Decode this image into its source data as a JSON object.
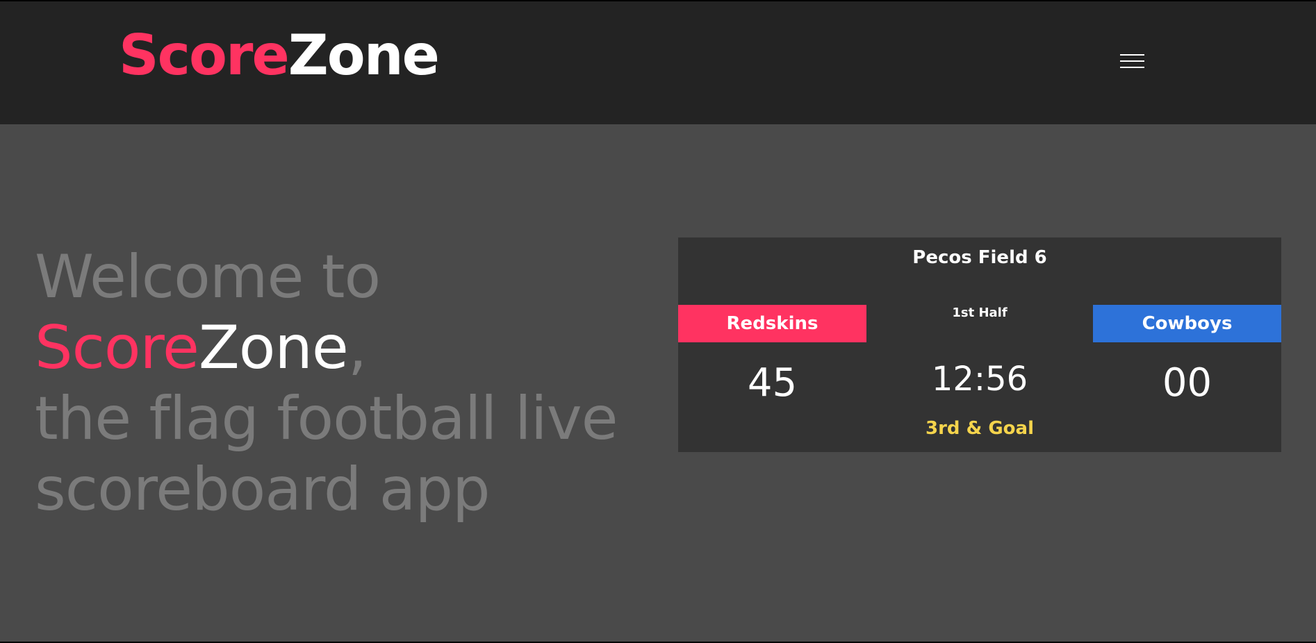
{
  "header": {
    "logo_part1": "Score",
    "logo_part2": "Zone",
    "menu_icon": "hamburger-menu-icon"
  },
  "hero": {
    "line1": "Welcome to",
    "brand_part1": "Score",
    "brand_part2": "Zone",
    "brand_suffix": ",",
    "line3": "the flag football live",
    "line4": "scoreboard app"
  },
  "scoreboard": {
    "field": "Pecos Field 6",
    "period": "1st Half",
    "clock": "12:56",
    "down": "3rd & Goal",
    "home": {
      "name": "Redskins",
      "score": "45",
      "color": "#ff3361"
    },
    "away": {
      "name": "Cowboys",
      "score": "00",
      "color": "#2d72d9"
    }
  },
  "colors": {
    "accent": "#ff3361",
    "header_bg": "#232323",
    "page_bg": "#4a4a4a",
    "card_bg": "#333333",
    "down_text": "#f5d44c"
  }
}
